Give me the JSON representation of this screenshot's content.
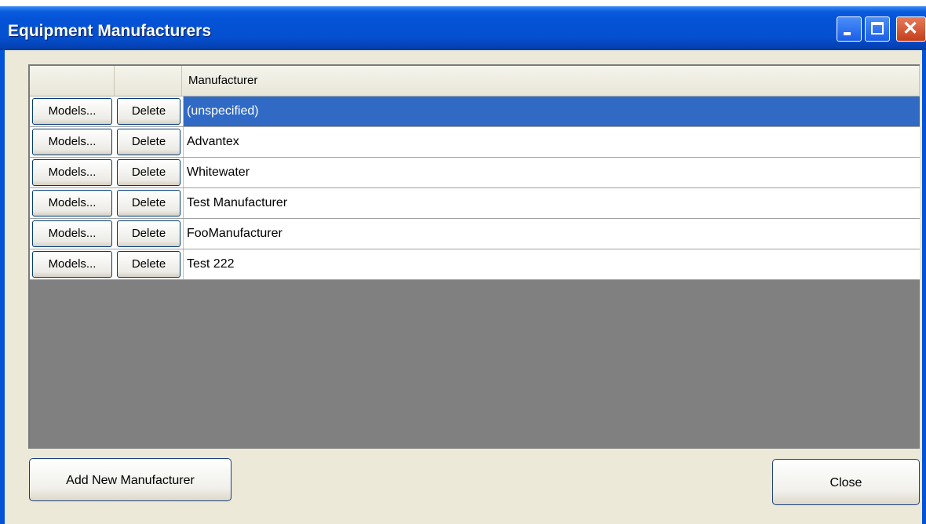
{
  "window": {
    "title": "Equipment Manufacturers",
    "controls": {
      "minimize": "minimize",
      "maximize": "maximize",
      "close": "✕"
    }
  },
  "grid": {
    "columns": [
      "",
      "",
      "Manufacturer"
    ],
    "row_buttons": {
      "models_label": "Models...",
      "delete_label": "Delete"
    },
    "rows": [
      {
        "name": "(unspecified)",
        "selected": true
      },
      {
        "name": "Advantex",
        "selected": false
      },
      {
        "name": "Whitewater",
        "selected": false
      },
      {
        "name": "Test Manufacturer",
        "selected": false
      },
      {
        "name": "FooManufacturer",
        "selected": false
      },
      {
        "name": "Test 222",
        "selected": false
      }
    ]
  },
  "footer": {
    "add_label": "Add New Manufacturer",
    "close_label": "Close"
  },
  "colors": {
    "titlebar": "#0453d6",
    "selection": "#316ac5",
    "grid_empty": "#808080",
    "window_bg": "#ece9d8"
  }
}
